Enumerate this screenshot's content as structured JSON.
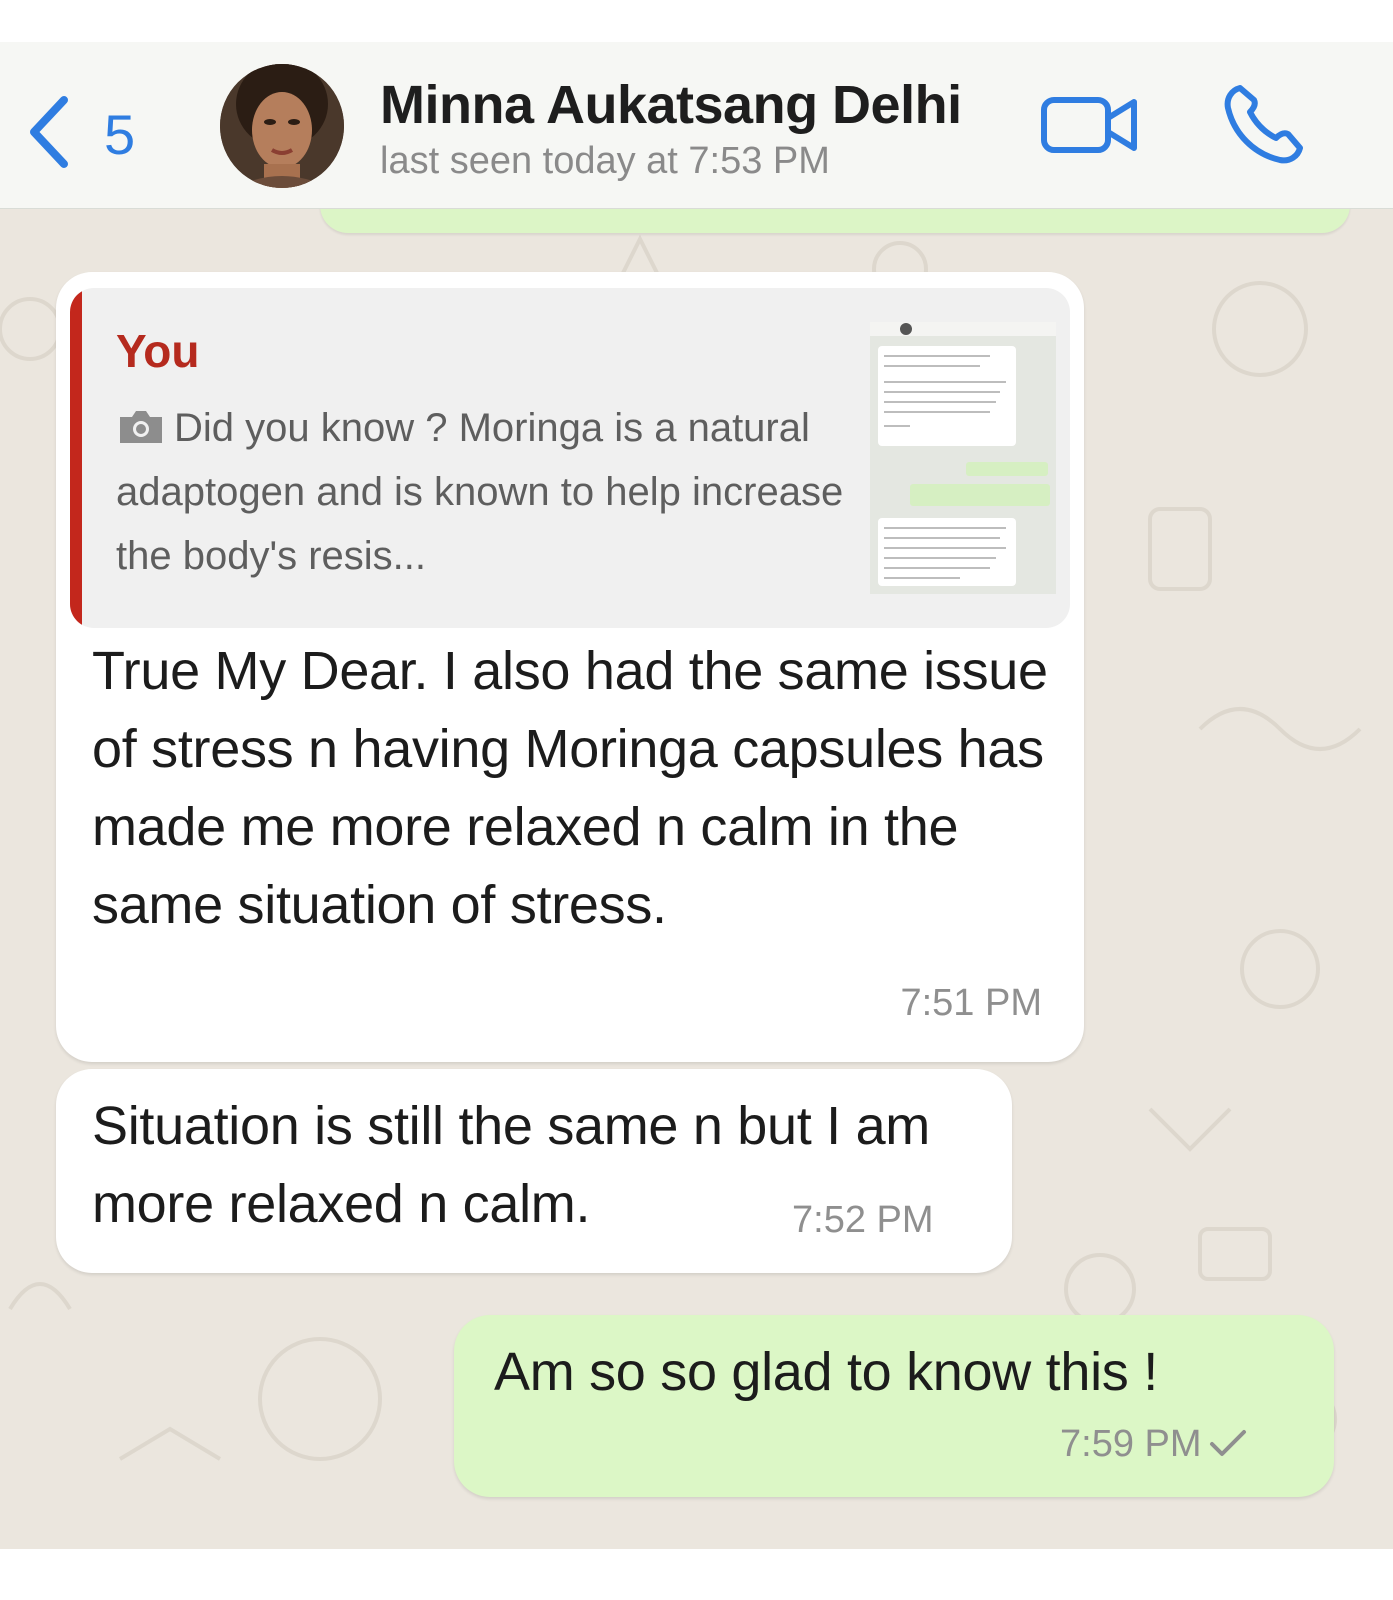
{
  "header": {
    "back_count": "5",
    "contact_name": "Minna Aukatsang Delhi",
    "status": "last seen today at 7:53 PM",
    "accent_color": "#2f7de1"
  },
  "messages": [
    {
      "direction": "incoming",
      "quote": {
        "author": "You",
        "icon": "camera-icon",
        "text": "Did you know ? Moringa is a natural adaptogen and is known to help increase the body's resis..."
      },
      "text": "True My Dear. I also had the same issue of stress n having Moringa capsules has made me more relaxed n calm in the same situation of stress.",
      "time": "7:51 PM"
    },
    {
      "direction": "incoming",
      "text": "Situation is still the same n but I am more relaxed n calm.",
      "time": "7:52 PM"
    },
    {
      "direction": "outgoing",
      "text": "Am so so glad to know this !",
      "time": "7:59 PM",
      "status_icon": "check-icon"
    }
  ],
  "colors": {
    "chat_background": "#ebe6de",
    "incoming_bubble": "#ffffff",
    "outgoing_bubble": "#dcf7c6",
    "quote_accent": "#c3271c"
  }
}
